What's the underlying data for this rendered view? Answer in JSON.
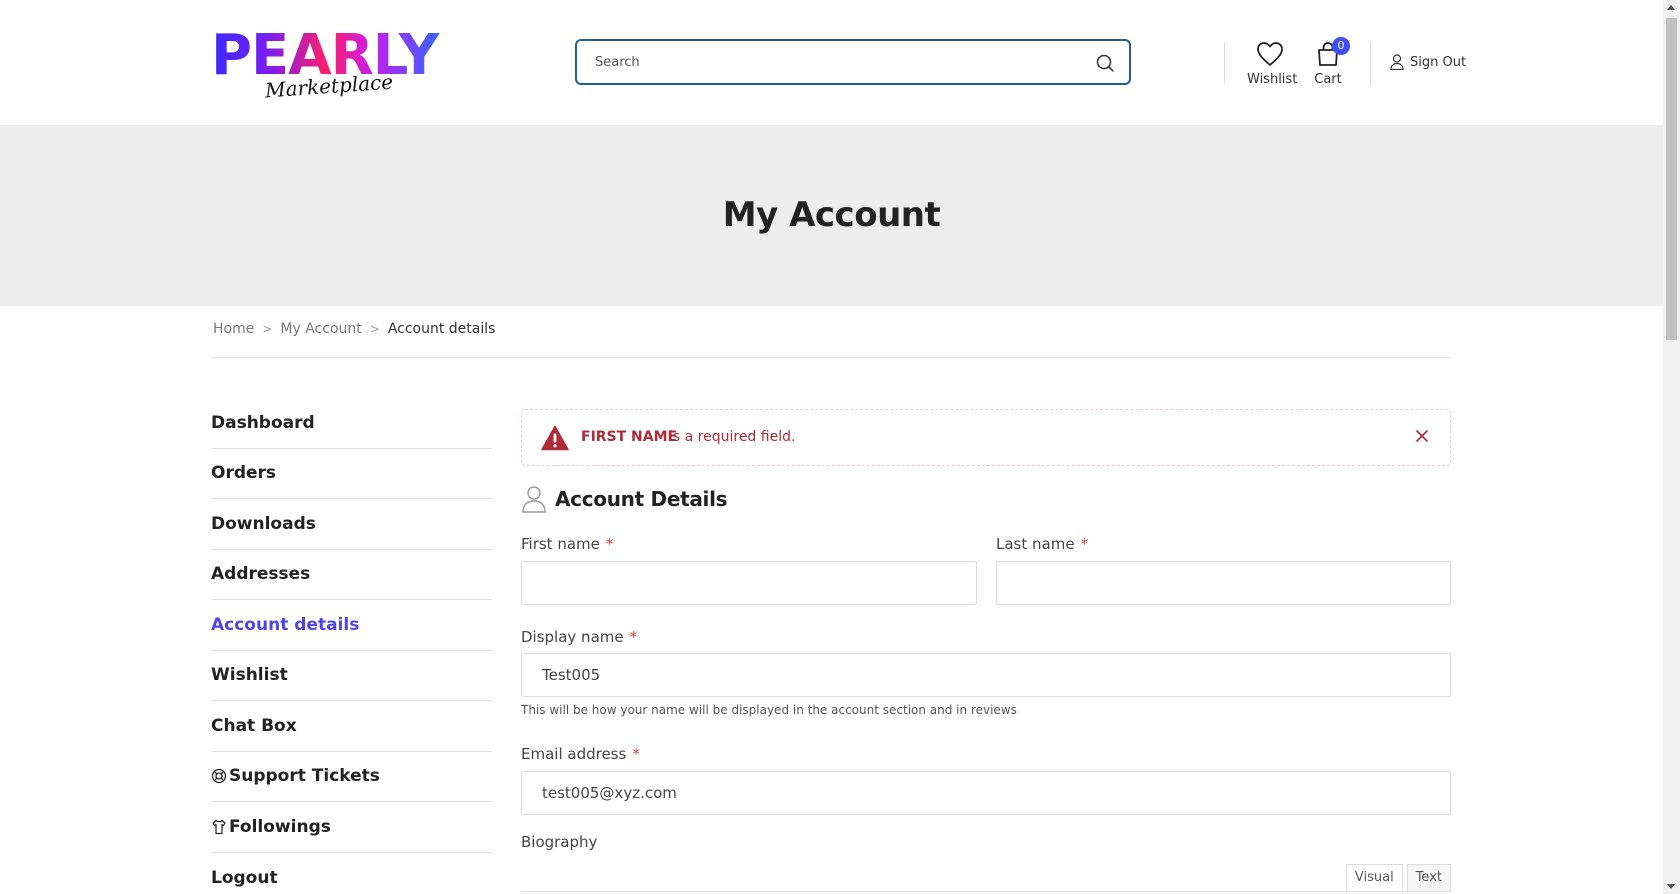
{
  "header": {
    "logo_main": "PEARLY",
    "logo_sub": "Marketplace",
    "search_placeholder": "Search",
    "wishlist_label": "Wishlist",
    "cart_label": "Cart",
    "cart_count": "0",
    "signout_label": "Sign Out"
  },
  "hero": {
    "title": "My Account"
  },
  "breadcrumb": {
    "items": [
      "Home",
      "My Account"
    ],
    "current": "Account details",
    "separator": ">"
  },
  "sidebar": {
    "items": [
      {
        "label": "Dashboard",
        "active": false
      },
      {
        "label": "Orders",
        "active": false
      },
      {
        "label": "Downloads",
        "active": false
      },
      {
        "label": "Addresses",
        "active": false
      },
      {
        "label": "Account details",
        "active": true
      },
      {
        "label": "Wishlist",
        "active": false
      },
      {
        "label": "Chat Box",
        "active": false
      },
      {
        "label": "Support Tickets",
        "active": false,
        "icon": "lifebuoy-icon"
      },
      {
        "label": "Followings",
        "active": false,
        "icon": "shirt-icon"
      },
      {
        "label": "Logout",
        "active": false
      }
    ]
  },
  "alert": {
    "field": "FIRST NAME",
    "message": "is a required field."
  },
  "form": {
    "title": "Account Details",
    "first_name_label": "First name",
    "first_name_value": "",
    "last_name_label": "Last name",
    "last_name_value": "",
    "display_name_label": "Display name",
    "display_name_value": "Test005",
    "display_name_hint": "This will be how your name will be displayed in the account section and in reviews",
    "email_label": "Email address",
    "email_value": "test005@xyz.com",
    "biography_label": "Biography",
    "required_mark": "*",
    "editor_tabs": [
      "Visual",
      "Text"
    ]
  },
  "colors": {
    "accent": "#4f46e5",
    "error": "#b02a37",
    "required": "#e53935",
    "hero_bg": "#ededed",
    "search_border": "#1f5e9e",
    "badge": "#3d4ff2"
  }
}
